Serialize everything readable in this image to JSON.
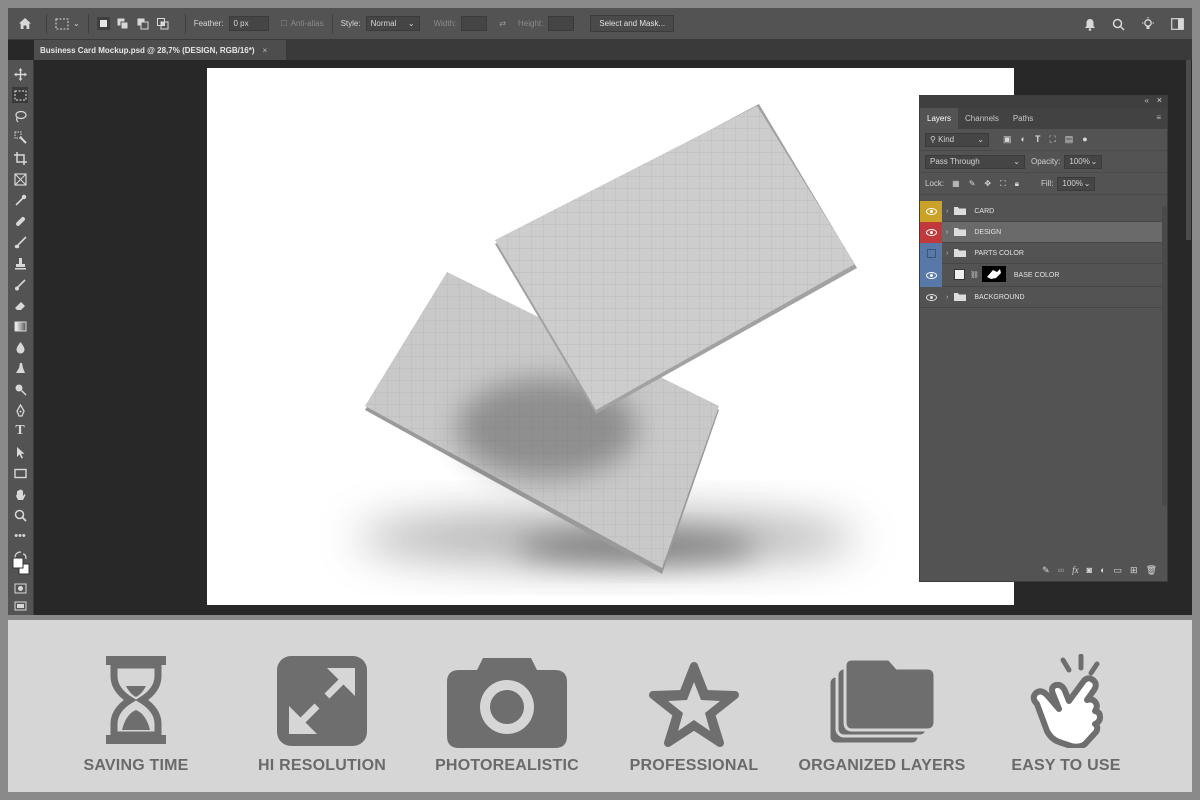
{
  "options_bar": {
    "feather_label": "Feather:",
    "feather_value": "0 px",
    "antialias_label": "Anti-alias",
    "style_label": "Style:",
    "style_value": "Normal",
    "width_label": "Width:",
    "height_label": "Height:",
    "select_mask_label": "Select and Mask..."
  },
  "document": {
    "tab_title": "Business Card Mockup.psd @ 28,7% (DESIGN, RGB/16*)",
    "close_glyph": "×"
  },
  "layers_panel": {
    "tabs": [
      "Layers",
      "Channels",
      "Paths"
    ],
    "kind_label": "Kind",
    "blend_mode": "Pass Through",
    "opacity_label": "Opacity:",
    "opacity_value": "100%",
    "lock_label": "Lock:",
    "fill_label": "Fill:",
    "fill_value": "100%",
    "layers": [
      {
        "name": "CARD",
        "color": "#c9a227",
        "type": "group"
      },
      {
        "name": "DESIGN",
        "color": "#c0393b",
        "type": "group",
        "selected": true
      },
      {
        "name": "PARTS COLOR",
        "color": "#5879a8",
        "type": "group",
        "hidden": true
      },
      {
        "name": "BASE COLOR",
        "color": "#5879a8",
        "type": "layer"
      },
      {
        "name": "BACKGROUND",
        "color": "",
        "type": "group"
      }
    ]
  },
  "features": [
    {
      "label": "SAVING TIME",
      "icon": "hourglass-icon"
    },
    {
      "label": "HI RESOLUTION",
      "icon": "expand-arrows-icon"
    },
    {
      "label": "PHOTOREALISTIC",
      "icon": "camera-icon"
    },
    {
      "label": "PROFESSIONAL",
      "icon": "star-icon"
    },
    {
      "label": "ORGANIZED LAYERS",
      "icon": "stacked-folders-icon"
    },
    {
      "label": "EASY TO USE",
      "icon": "tap-hand-icon"
    }
  ],
  "colors": {
    "ui_dark": "#282828",
    "ui_mid": "#535353",
    "feature_bg": "#d6d6d6",
    "feature_icon": "#6e6e6e"
  }
}
